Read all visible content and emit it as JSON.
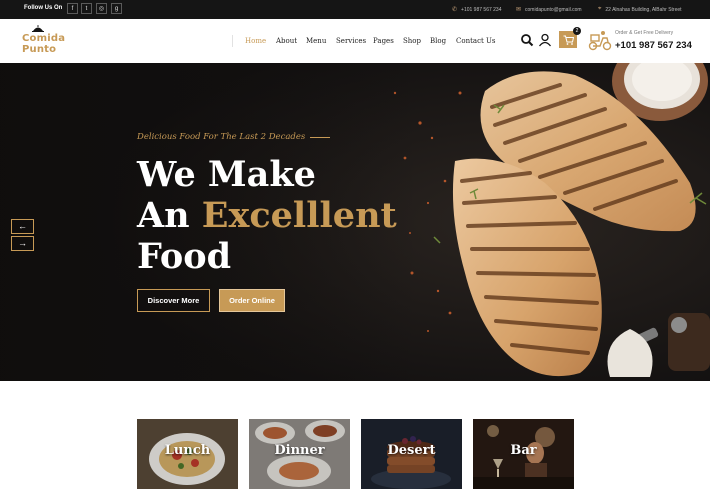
{
  "topbar": {
    "follow_label": "Follow Us On",
    "social": [
      {
        "icon": "facebook-icon",
        "glyph": "f"
      },
      {
        "icon": "twitter-icon",
        "glyph": "t"
      },
      {
        "icon": "instagram-icon",
        "glyph": "◎"
      },
      {
        "icon": "google-plus-icon",
        "glyph": "g"
      }
    ],
    "phone": "+101 987 567 234",
    "email": "comidapunto@gmail.com",
    "address": "22 Alnahas Building, AlBahr Street"
  },
  "header": {
    "logo": {
      "line1": "Comida",
      "line2": "Punto"
    },
    "nav": [
      "Home",
      "About",
      "Menu",
      "Services",
      "Pages",
      "Shop",
      "Blog",
      "Contact Us"
    ],
    "active_nav": "Home",
    "cart_count": "2",
    "delivery_label": "Order & Get Free Delivery",
    "delivery_phone": "+101 987 567 234"
  },
  "hero": {
    "tagline": "Delicious Food For The Last 2 Decades",
    "headline_line1": "We Make",
    "headline_line2_prefix": "An",
    "headline_line2_accent": "Excelllent",
    "headline_line3": "Food",
    "primary_button": "Discover More",
    "secondary_button": "Order Online",
    "prev_arrow": "←",
    "next_arrow": "→"
  },
  "categories": [
    "Lunch",
    "Dinner",
    "Desert",
    "Bar"
  ],
  "colors": {
    "accent": "#c79a56",
    "dark": "#151515",
    "hero_bg": "#141210"
  }
}
